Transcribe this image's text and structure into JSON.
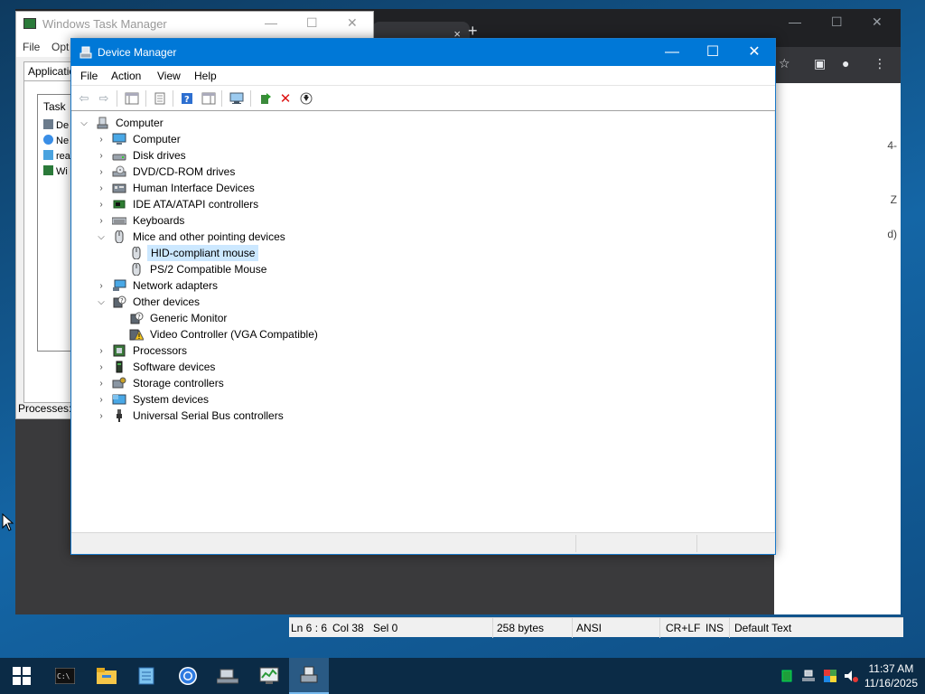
{
  "task_manager": {
    "title": "Windows Task Manager",
    "menu": [
      "File",
      "Opt"
    ],
    "tab_label": "Application",
    "list_header": "Task",
    "list_items": [
      "De",
      "Ne",
      "rea",
      "Wi"
    ],
    "processes_label": "Processes:"
  },
  "chrome": {
    "tab_close": "×",
    "new_tab": "+",
    "page_fragments": [
      "4-",
      "Z",
      "d)"
    ]
  },
  "notepad_status": {
    "position": "Ln 6 : 6",
    "column": "Col 38",
    "selection": "Sel 0",
    "size": "258 bytes",
    "encoding": "ANSI",
    "line_ending": "CR+LF",
    "mode": "INS",
    "style": "Default Text"
  },
  "device_manager": {
    "title": "Device Manager",
    "menu": {
      "file": "File",
      "action": "Action",
      "view": "View",
      "help": "Help"
    },
    "tree": {
      "root": "Computer",
      "items": [
        {
          "label": "Computer",
          "expanded": false,
          "icon": "monitor-icon"
        },
        {
          "label": "Disk drives",
          "expanded": false,
          "icon": "disk-drive-icon"
        },
        {
          "label": "DVD/CD-ROM drives",
          "expanded": false,
          "icon": "dvd-drive-icon"
        },
        {
          "label": "Human Interface Devices",
          "expanded": false,
          "icon": "hid-icon"
        },
        {
          "label": "IDE ATA/ATAPI controllers",
          "expanded": false,
          "icon": "ide-controller-icon"
        },
        {
          "label": "Keyboards",
          "expanded": false,
          "icon": "keyboard-icon"
        },
        {
          "label": "Mice and other pointing devices",
          "expanded": true,
          "icon": "mouse-icon",
          "children": [
            {
              "label": "HID-compliant mouse",
              "selected": true,
              "icon": "mouse-icon"
            },
            {
              "label": "PS/2 Compatible Mouse",
              "selected": false,
              "icon": "mouse-icon"
            }
          ]
        },
        {
          "label": "Network adapters",
          "expanded": false,
          "icon": "network-adapter-icon"
        },
        {
          "label": "Other devices",
          "expanded": true,
          "icon": "unknown-device-icon",
          "children": [
            {
              "label": "Generic Monitor",
              "selected": false,
              "icon": "unknown-device-icon"
            },
            {
              "label": "Video Controller (VGA Compatible)",
              "selected": false,
              "icon": "warning-device-icon"
            }
          ]
        },
        {
          "label": "Processors",
          "expanded": false,
          "icon": "processor-icon"
        },
        {
          "label": "Software devices",
          "expanded": false,
          "icon": "software-device-icon"
        },
        {
          "label": "Storage controllers",
          "expanded": false,
          "icon": "storage-controller-icon"
        },
        {
          "label": "System devices",
          "expanded": false,
          "icon": "system-device-icon"
        },
        {
          "label": "Universal Serial Bus controllers",
          "expanded": false,
          "icon": "usb-icon"
        }
      ]
    }
  },
  "taskbar": {
    "apps": [
      "start-icon",
      "cmd-icon",
      "file-explorer-icon",
      "notepad-icon",
      "chrome-icon",
      "network-share-icon",
      "task-manager-icon",
      "device-manager-icon"
    ],
    "time": "11:37 AM",
    "date": "11/16/2025"
  },
  "colors": {
    "titlebar_active": "#0078d7",
    "selection": "#cce8ff",
    "taskbar": "#0b2b46"
  }
}
